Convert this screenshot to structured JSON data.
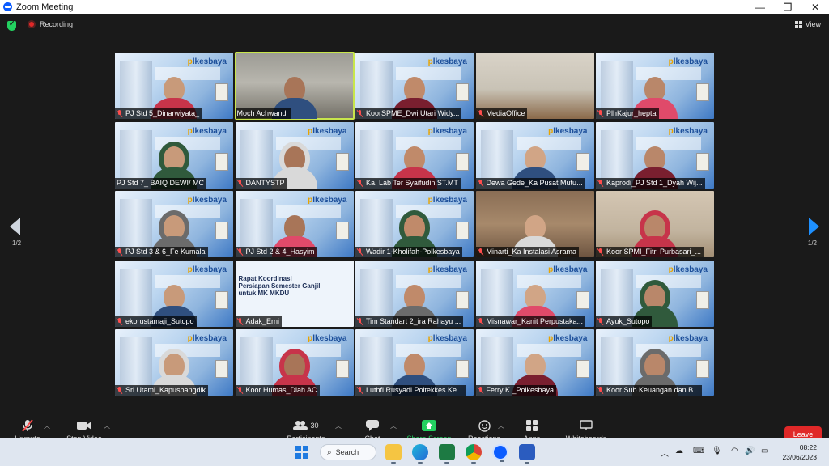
{
  "window": {
    "title": "Zoom Meeting",
    "minimize": "—",
    "maximize": "❐",
    "close": "✕"
  },
  "topbar": {
    "recording": "Recording",
    "view": "View"
  },
  "pagination": {
    "left": "1/2",
    "right": "1/2"
  },
  "slide": {
    "line1": "Rapat Koordinasi",
    "line2": "Persiapan Semester Ganjil",
    "line3": "untuk MK MKDU"
  },
  "poster": {
    "brand_a": "p",
    "brand_b": "lkesbaya"
  },
  "participants": [
    {
      "name": "PJ Std 5_Dinarwiyata_",
      "muted": true
    },
    {
      "name": "Moch Achwandi",
      "muted": false
    },
    {
      "name": "KoorSPME_Dwi Utari Widy...",
      "muted": true
    },
    {
      "name": "MediaOffice",
      "muted": true
    },
    {
      "name": "PlhKajur_hepta",
      "muted": true
    },
    {
      "name": "PJ Std 7_ BAIQ DEWI/ MC",
      "muted": false
    },
    {
      "name": "DANTYSTP",
      "muted": true
    },
    {
      "name": "Ka. Lab Ter Syaifudin,ST.MT",
      "muted": true
    },
    {
      "name": "Dewa Gede_Ka Pusat Mutu...",
      "muted": true
    },
    {
      "name": "Kaprodi_PJ Std 1_Dyah Wij...",
      "muted": true
    },
    {
      "name": "PJ Std 3 & 6_Fe Kumala",
      "muted": true
    },
    {
      "name": "PJ Std 2 & 4_Hasyim",
      "muted": true
    },
    {
      "name": "Wadir 1-Kholifah-Polkesbaya",
      "muted": true
    },
    {
      "name": "Minarti_Ka Instalasi Asrama",
      "muted": true
    },
    {
      "name": "Koor SPMI_Fitri Purbasari_...",
      "muted": true
    },
    {
      "name": "ekorustamaji_Sutopo",
      "muted": true
    },
    {
      "name": "Adak_Erni",
      "muted": true
    },
    {
      "name": "Tim Standart 2_ira Rahayu ...",
      "muted": true
    },
    {
      "name": "Misnawar_Kanit Perpustaka...",
      "muted": true
    },
    {
      "name": "Ayuk_Sutopo",
      "muted": true
    },
    {
      "name": "Sri Utami_Kapusbangdik",
      "muted": true
    },
    {
      "name": "Koor Humas_Diah AC",
      "muted": true
    },
    {
      "name": "Luthfi Rusyadi Poltekkes Ke...",
      "muted": true
    },
    {
      "name": "Ferry K._Polkesbaya",
      "muted": true
    },
    {
      "name": "Koor Sub Keuangan dan B...",
      "muted": true
    }
  ],
  "toolbar": {
    "unmute": "Unmute",
    "stop_video": "Stop Video",
    "participants": "Participants",
    "participants_count": "30",
    "chat": "Chat",
    "share_screen": "Share Screen",
    "reactions": "Reactions",
    "apps": "Apps",
    "whiteboards": "Whiteboards",
    "leave": "Leave"
  },
  "taskbar": {
    "search": "Search",
    "time": "08:22",
    "date": "23/06/2023"
  },
  "colors": {
    "share_green": "#23d160",
    "leave_red": "#e02828",
    "active_speaker": "#c8e64c",
    "muted_red": "#ff4d4d"
  }
}
